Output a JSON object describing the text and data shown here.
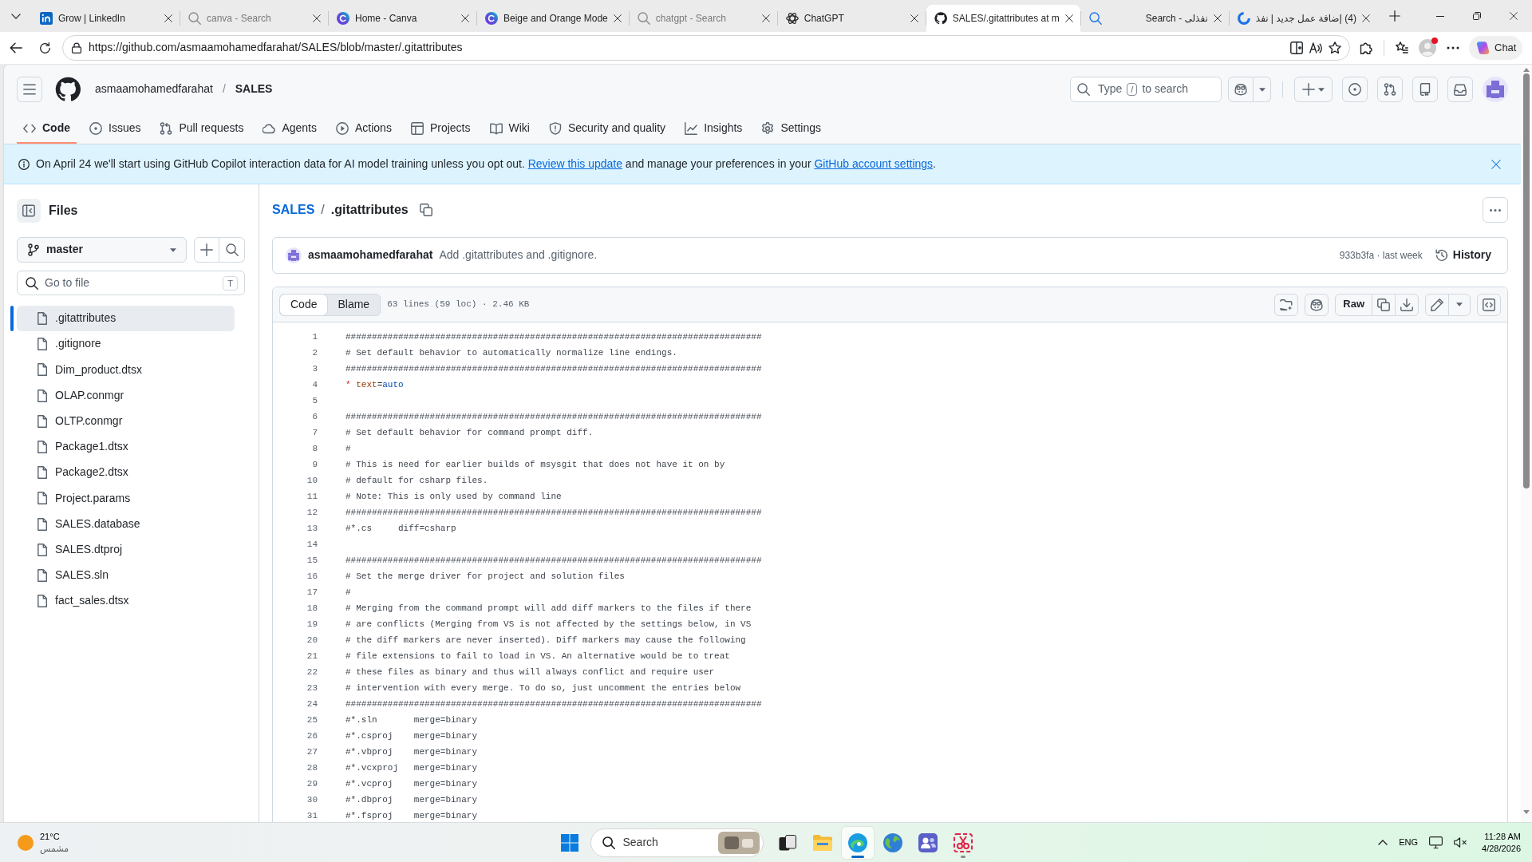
{
  "browser": {
    "tabs": [
      {
        "kind": "square-logo",
        "title": "Grow | LinkedIn",
        "selected": false,
        "sleeping": false
      },
      {
        "kind": "search",
        "title": "canva - Search",
        "selected": false,
        "sleeping": true
      },
      {
        "kind": "circle-logo",
        "title": "Home - Canva",
        "selected": false,
        "sleeping": false
      },
      {
        "kind": "circle-logo",
        "title": "Beige and Orange Mode",
        "selected": false,
        "sleeping": false
      },
      {
        "kind": "search",
        "title": "chatgpt - Search",
        "selected": false,
        "sleeping": true
      },
      {
        "kind": "knot-logo",
        "title": "ChatGPT",
        "selected": false,
        "sleeping": false
      },
      {
        "kind": "cat-logo",
        "title": "SALES/.gitattributes at m",
        "selected": true,
        "sleeping": false
      },
      {
        "kind": "search",
        "title": "نفذلى - Search",
        "selected": false,
        "sleeping": false
      },
      {
        "kind": "swirl-logo",
        "title": "(4) إضافة عمل جديد | نفذ",
        "selected": false,
        "sleeping": false
      }
    ],
    "url": "https://github.com/asmaamohamedfarahat/SALES/blob/master/.gitattributes",
    "chat_button": "Chat"
  },
  "github": {
    "owner": "asmaamohamedfarahat",
    "separator": "/",
    "repo": "SALES",
    "search": {
      "before": "Type",
      "key": "/",
      "after": "to search"
    }
  },
  "repo_nav": [
    {
      "kind": "code",
      "label": "Code",
      "selected": true
    },
    {
      "kind": "issues",
      "label": "Issues",
      "selected": false
    },
    {
      "kind": "pulls",
      "label": "Pull requests",
      "selected": false
    },
    {
      "kind": "agents",
      "label": "Agents",
      "selected": false
    },
    {
      "kind": "actions",
      "label": "Actions",
      "selected": false
    },
    {
      "kind": "projects",
      "label": "Projects",
      "selected": false
    },
    {
      "kind": "wiki",
      "label": "Wiki",
      "selected": false
    },
    {
      "kind": "security",
      "label": "Security and quality",
      "selected": false
    },
    {
      "kind": "insights",
      "label": "Insights",
      "selected": false
    },
    {
      "kind": "settings",
      "label": "Settings",
      "selected": false
    }
  ],
  "banner": {
    "parts": [
      {
        "kind": "text",
        "text": "On April 24 we'll start using GitHub Copilot interaction data for AI model training unless you opt out. "
      },
      {
        "kind": "link",
        "text": "Review this update"
      },
      {
        "kind": "text",
        "text": " and manage your preferences in your "
      },
      {
        "kind": "link",
        "text": "GitHub account settings"
      },
      {
        "kind": "text",
        "text": "."
      }
    ]
  },
  "sidebar": {
    "title": "Files",
    "branch": "master",
    "filter": {
      "placeholder": "Go to file",
      "shortcut": "T"
    },
    "files": [
      {
        "name": ".gitattributes",
        "selected": true
      },
      {
        "name": ".gitignore",
        "selected": false
      },
      {
        "name": "Dim_product.dtsx",
        "selected": false
      },
      {
        "name": "OLAP.conmgr",
        "selected": false
      },
      {
        "name": "OLTP.conmgr",
        "selected": false
      },
      {
        "name": "Package1.dtsx",
        "selected": false
      },
      {
        "name": "Package2.dtsx",
        "selected": false
      },
      {
        "name": "Project.params",
        "selected": false
      },
      {
        "name": "SALES.database",
        "selected": false
      },
      {
        "name": "SALES.dtproj",
        "selected": false
      },
      {
        "name": "SALES.sln",
        "selected": false
      },
      {
        "name": "fact_sales.dtsx",
        "selected": false
      }
    ]
  },
  "file": {
    "repo": "SALES",
    "separator": "/",
    "name": ".gitattributes",
    "commit": {
      "author": "asmaamohamedfarahat",
      "message": "Add .gitattributes and .gitignore.",
      "meta": "933b3fa · last week",
      "history": "History"
    },
    "views": [
      {
        "label": "Code",
        "selected": true
      },
      {
        "label": "Blame",
        "selected": false
      }
    ],
    "stats": "63 lines (59 loc) · 2.46 KB",
    "raw": "Raw",
    "lines": [
      {
        "number": "1",
        "text": "###############################################################################"
      },
      {
        "number": "2",
        "text": "# Set default behavior to automatically normalize line endings."
      },
      {
        "number": "3",
        "text": "###############################################################################"
      },
      {
        "number": "4",
        "tokens": [
          {
            "kind": "pattern",
            "text": "*"
          },
          {
            "kind": "attribute",
            "text": " text"
          },
          {
            "kind": "plain",
            "text": "="
          },
          {
            "kind": "value",
            "text": "auto"
          }
        ]
      },
      {
        "number": "5"
      },
      {
        "number": "6",
        "text": "###############################################################################"
      },
      {
        "number": "7",
        "text": "# Set default behavior for command prompt diff."
      },
      {
        "number": "8",
        "text": "#"
      },
      {
        "number": "9",
        "text": "# This is need for earlier builds of msysgit that does not have it on by"
      },
      {
        "number": "10",
        "text": "# default for csharp files."
      },
      {
        "number": "11",
        "text": "# Note: This is only used by command line"
      },
      {
        "number": "12",
        "text": "###############################################################################"
      },
      {
        "number": "13",
        "text": "#*.cs     diff=csharp"
      },
      {
        "number": "14"
      },
      {
        "number": "15",
        "text": "###############################################################################"
      },
      {
        "number": "16",
        "text": "# Set the merge driver for project and solution files"
      },
      {
        "number": "17",
        "text": "#"
      },
      {
        "number": "18",
        "text": "# Merging from the command prompt will add diff markers to the files if there"
      },
      {
        "number": "19",
        "text": "# are conflicts (Merging from VS is not affected by the settings below, in VS"
      },
      {
        "number": "20",
        "text": "# the diff markers are never inserted). Diff markers may cause the following"
      },
      {
        "number": "21",
        "text": "# file extensions to fail to load in VS. An alternative would be to treat"
      },
      {
        "number": "22",
        "text": "# these files as binary and thus will always conflict and require user"
      },
      {
        "number": "23",
        "text": "# intervention with every merge. To do so, just uncomment the entries below"
      },
      {
        "number": "24",
        "text": "###############################################################################"
      },
      {
        "number": "25",
        "text": "#*.sln       merge=binary"
      },
      {
        "number": "26",
        "text": "#*.csproj    merge=binary"
      },
      {
        "number": "27",
        "text": "#*.vbproj    merge=binary"
      },
      {
        "number": "28",
        "text": "#*.vcxproj   merge=binary"
      },
      {
        "number": "29",
        "text": "#*.vcproj    merge=binary"
      },
      {
        "number": "30",
        "text": "#*.dbproj    merge=binary"
      },
      {
        "number": "31",
        "text": "#*.fsproj    merge=binary"
      }
    ]
  },
  "taskbar": {
    "weather": {
      "temperature": "21°C",
      "condition": "مشمس"
    },
    "search": "Search",
    "apps": [
      {
        "kind": "task-view",
        "running": false,
        "active": false
      },
      {
        "kind": "folder",
        "running": false,
        "active": false
      },
      {
        "kind": "browser",
        "running": true,
        "active": true
      },
      {
        "kind": "globe",
        "running": false,
        "active": false
      },
      {
        "kind": "people",
        "running": false,
        "active": false
      },
      {
        "kind": "snip",
        "running": true,
        "active": false
      }
    ],
    "language": "ENG",
    "time": "11:28 AM",
    "date": "4/28/2026"
  }
}
